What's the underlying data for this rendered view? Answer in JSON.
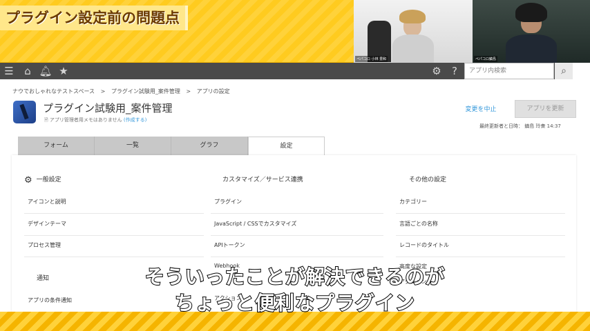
{
  "banner": {
    "title": "プラグイン設定前の問題点"
  },
  "cams": {
    "cam1_label": "ペパコロ 小林 豊和",
    "cam2_label": "ペパコロ鎮島"
  },
  "appbar": {
    "search_placeholder": "アプリ内検索"
  },
  "breadcrumb": [
    "ナウでおしゃれなテストスペース",
    ">",
    "プラグイン試験用_案件管理",
    ">",
    "アプリの設定"
  ],
  "app": {
    "title": "プラグイン試験用_案件管理",
    "memo": "アプリ管理者用メモはありません",
    "memo_link": "(作成する)",
    "cancel_label": "変更を中止",
    "update_label": "アプリを更新",
    "last_updated": "最終更新者と日時： 鎮島 玲衆 14:37"
  },
  "tabs": [
    "フォーム",
    "一覧",
    "グラフ",
    "設定"
  ],
  "settings": {
    "general": {
      "title": "一般設定",
      "items": [
        "アイコンと説明",
        "デザインテーマ",
        "プロセス管理"
      ]
    },
    "notify": {
      "title": "通知",
      "items": [
        "アプリの条件通知"
      ]
    },
    "custom": {
      "title": "カスタマイズ／サービス連携",
      "items": [
        "プラグイン",
        "JavaScript / CSSでカスタマイズ",
        "APIトークン",
        "Webhook",
        "アクション"
      ]
    },
    "other": {
      "title": "その他の設定",
      "items": [
        "カテゴリー",
        "言語ごとの名称",
        "レコードのタイトル",
        "高度な設定",
        "アクション"
      ]
    }
  },
  "subtitle": {
    "line1": "そういったことが解決できるのが",
    "line2": "ちょっと便利なプラグイン"
  }
}
